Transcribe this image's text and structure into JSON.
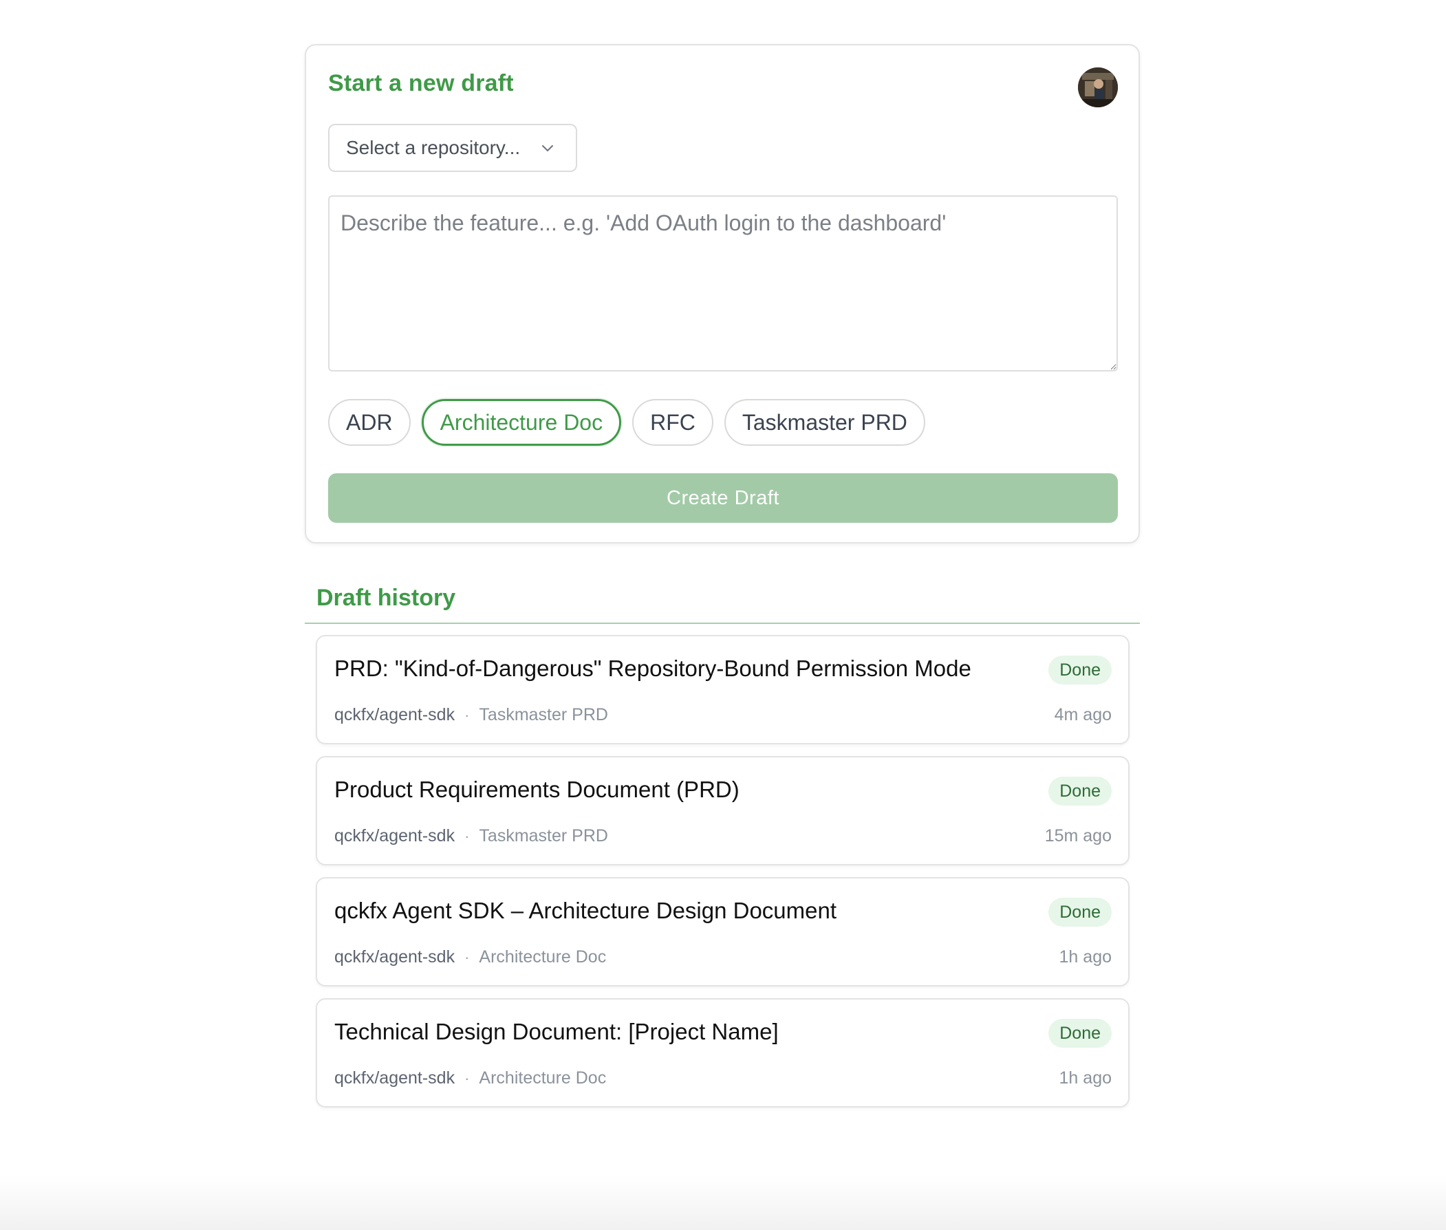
{
  "new_draft": {
    "title": "Start a new draft",
    "repo_select_label": "Select a repository...",
    "feature_placeholder": "Describe the feature... e.g. 'Add OAuth login to the dashboard'",
    "feature_value": "",
    "doc_types": [
      {
        "label": "ADR",
        "selected": false
      },
      {
        "label": "Architecture Doc",
        "selected": true
      },
      {
        "label": "RFC",
        "selected": false
      },
      {
        "label": "Taskmaster PRD",
        "selected": false
      }
    ],
    "create_button_label": "Create Draft"
  },
  "history": {
    "title": "Draft history",
    "items": [
      {
        "title": "PRD: \"Kind-of-Dangerous\" Repository-Bound Permission Mode",
        "status": "Done",
        "repo": "qckfx/agent-sdk",
        "separator": "·",
        "type": "Taskmaster PRD",
        "time": "4m ago"
      },
      {
        "title": "Product Requirements Document (PRD)",
        "status": "Done",
        "repo": "qckfx/agent-sdk",
        "separator": "·",
        "type": "Taskmaster PRD",
        "time": "15m ago"
      },
      {
        "title": "qckfx Agent SDK – Architecture Design Document",
        "status": "Done",
        "repo": "qckfx/agent-sdk",
        "separator": "·",
        "type": "Architecture Doc",
        "time": "1h ago"
      },
      {
        "title": "Technical Design Document: [Project Name]",
        "status": "Done",
        "repo": "qckfx/agent-sdk",
        "separator": "·",
        "type": "Architecture Doc",
        "time": "1h ago"
      }
    ]
  },
  "colors": {
    "accent": "#3f9a48",
    "button_disabled": "#a2caa6",
    "badge_bg": "#e6f6e8",
    "badge_text": "#2f6b37"
  },
  "icons": {
    "repo_select": "chevron-down-icon",
    "avatar": "user-avatar"
  }
}
